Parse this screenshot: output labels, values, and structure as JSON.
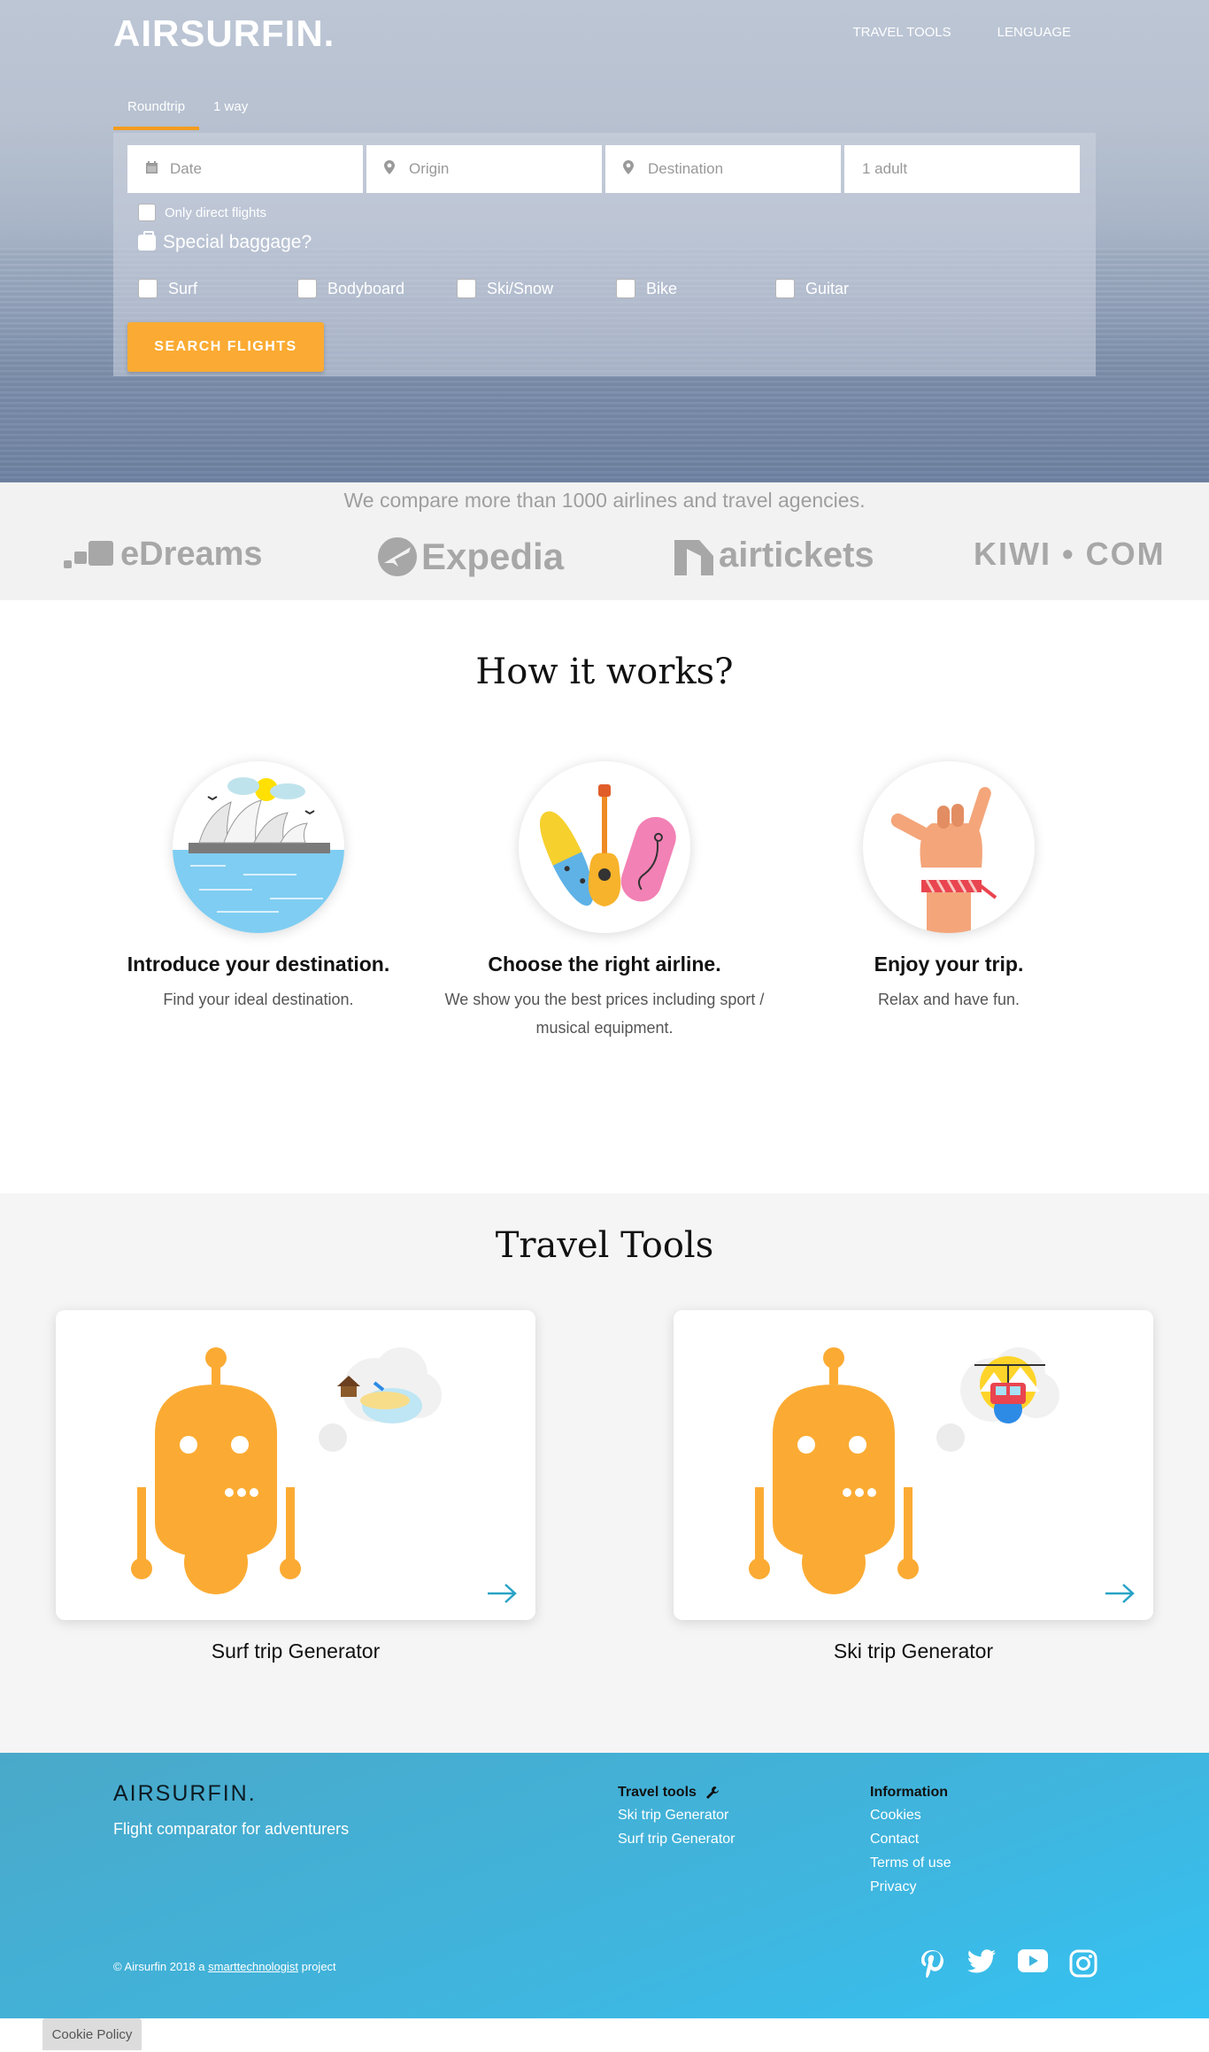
{
  "header": {
    "logo": "AIRSURFIN.",
    "nav": [
      "TRAVEL TOOLS",
      "LENGUAGE"
    ]
  },
  "search": {
    "tabs": [
      "Roundtrip",
      "1 way"
    ],
    "active_tab": "Roundtrip",
    "fields": {
      "date": {
        "placeholder": "Date",
        "icon": "calendar-icon"
      },
      "origin": {
        "placeholder": "Origin",
        "icon": "map-marker-icon"
      },
      "destination": {
        "placeholder": "Destination",
        "icon": "map-marker-icon"
      },
      "passengers": {
        "value": "1 adult"
      }
    },
    "direct_label": "Only direct flights",
    "baggage_label": "Special baggage?",
    "equipment": [
      "Surf",
      "Bodyboard",
      "Ski/Snow",
      "Bike",
      "Guitar"
    ],
    "button": "SEARCH  FLIGHTS"
  },
  "partners": {
    "heading": "We compare more than 1000 airlines and travel agencies.",
    "logos": [
      "eDreams",
      "Expedia",
      "airtickets",
      "KIWI • COM"
    ]
  },
  "how": {
    "title": "How it works?",
    "steps": [
      {
        "title": "Introduce your destination.",
        "text": "Find your ideal destination.",
        "image": "sydney-opera-illustration"
      },
      {
        "title": "Choose the right airline.",
        "text": "We show you the best prices including sport / musical equipment.",
        "image": "surfboard-guitar-bodyboard-illustration"
      },
      {
        "title": "Enjoy your trip.",
        "text": "Relax and have fun.",
        "image": "shaka-hand-illustration"
      }
    ]
  },
  "tools": {
    "title": "Travel Tools",
    "cards": [
      {
        "label": "Surf trip Generator",
        "image": "robot-beach-illustration"
      },
      {
        "label": "Ski trip Generator",
        "image": "robot-ski-illustration"
      }
    ]
  },
  "footer": {
    "logo": "AIRSURFIN.",
    "tagline": "Flight comparator for adventurers",
    "col1_title": "Travel tools",
    "col1_links": [
      "Ski trip Generator",
      "Surf trip Generator"
    ],
    "col2_title": "Information",
    "col2_links": [
      "Cookies",
      "Contact",
      "Terms of use",
      "Privacy"
    ],
    "copy_prefix": "© Airsurfin 2018 a ",
    "copy_link": "smarttechnologist",
    "copy_suffix": " project",
    "social": [
      "pinterest-icon",
      "twitter-icon",
      "youtube-icon",
      "instagram-icon"
    ]
  },
  "cookie": "Cookie Policy",
  "colors": {
    "accent": "#fbab33",
    "footer": "#3fb5de",
    "robot": "#fbab33"
  }
}
